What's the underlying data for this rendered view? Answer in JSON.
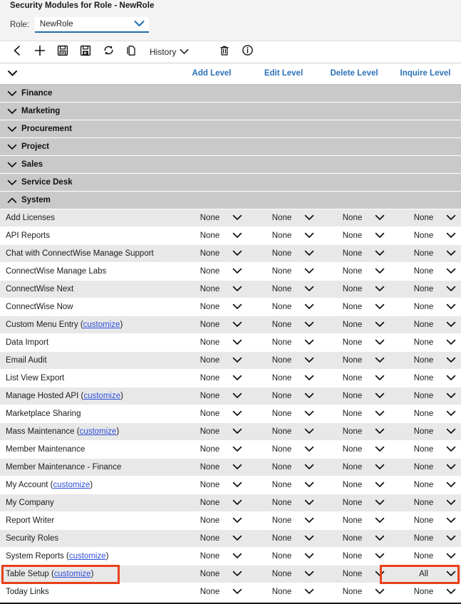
{
  "header": {
    "title": "Security Modules for Role - NewRole",
    "role_label": "Role:",
    "role_value": "NewRole"
  },
  "toolbar": {
    "items": [
      {
        "name": "back-button",
        "icon": "chevron-left-icon",
        "label": ""
      },
      {
        "name": "add-button",
        "icon": "plus-icon",
        "label": ""
      },
      {
        "name": "save-button",
        "icon": "save-icon",
        "label": ""
      },
      {
        "name": "save-and-close-button",
        "icon": "save-and-close-icon",
        "label": ""
      },
      {
        "name": "refresh-button",
        "icon": "refresh-icon",
        "label": ""
      },
      {
        "name": "copy-button",
        "icon": "copy-icon",
        "label": ""
      }
    ],
    "history_label": "History",
    "delete_label": "",
    "info_label": ""
  },
  "columns": [
    "Add Level",
    "Edit Level",
    "Delete Level",
    "Inquire Level"
  ],
  "groups": [
    {
      "label": "Finance",
      "expanded": false
    },
    {
      "label": "Marketing",
      "expanded": false
    },
    {
      "label": "Procurement",
      "expanded": false
    },
    {
      "label": "Project",
      "expanded": false
    },
    {
      "label": "Sales",
      "expanded": false
    },
    {
      "label": "Service Desk",
      "expanded": false
    },
    {
      "label": "System",
      "expanded": true
    }
  ],
  "customize_label": "customize",
  "rows": [
    {
      "name": "Add Licenses",
      "customize": false,
      "levels": [
        "None",
        "None",
        "None",
        "None"
      ]
    },
    {
      "name": "API Reports",
      "customize": false,
      "levels": [
        "None",
        "None",
        "None",
        "None"
      ]
    },
    {
      "name": "Chat with ConnectWise Manage Support",
      "customize": false,
      "levels": [
        "None",
        "None",
        "None",
        "None"
      ]
    },
    {
      "name": "ConnectWise Manage Labs",
      "customize": false,
      "levels": [
        "None",
        "None",
        "None",
        "None"
      ]
    },
    {
      "name": "ConnectWise Next",
      "customize": false,
      "levels": [
        "None",
        "None",
        "None",
        "None"
      ]
    },
    {
      "name": "ConnectWise Now",
      "customize": false,
      "levels": [
        "None",
        "None",
        "None",
        "None"
      ]
    },
    {
      "name": "Custom Menu Entry",
      "customize": true,
      "levels": [
        "None",
        "None",
        "None",
        "None"
      ]
    },
    {
      "name": "Data Import",
      "customize": false,
      "levels": [
        "None",
        "None",
        "None",
        "None"
      ]
    },
    {
      "name": "Email Audit",
      "customize": false,
      "levels": [
        "None",
        "None",
        "None",
        "None"
      ]
    },
    {
      "name": "List View Export",
      "customize": false,
      "levels": [
        "None",
        "None",
        "None",
        "None"
      ]
    },
    {
      "name": "Manage Hosted API",
      "customize": true,
      "levels": [
        "None",
        "None",
        "None",
        "None"
      ]
    },
    {
      "name": "Marketplace Sharing",
      "customize": false,
      "levels": [
        "None",
        "None",
        "None",
        "None"
      ]
    },
    {
      "name": "Mass Maintenance",
      "customize": true,
      "levels": [
        "None",
        "None",
        "None",
        "None"
      ]
    },
    {
      "name": "Member Maintenance",
      "customize": false,
      "levels": [
        "None",
        "None",
        "None",
        "None"
      ]
    },
    {
      "name": "Member Maintenance - Finance",
      "customize": false,
      "levels": [
        "None",
        "None",
        "None",
        "None"
      ]
    },
    {
      "name": "My Account",
      "customize": true,
      "levels": [
        "None",
        "None",
        "None",
        "None"
      ]
    },
    {
      "name": "My Company",
      "customize": false,
      "levels": [
        "None",
        "None",
        "None",
        "None"
      ]
    },
    {
      "name": "Report Writer",
      "customize": false,
      "levels": [
        "None",
        "None",
        "None",
        "None"
      ]
    },
    {
      "name": "Security Roles",
      "customize": false,
      "levels": [
        "None",
        "None",
        "None",
        "None"
      ]
    },
    {
      "name": "System Reports",
      "customize": true,
      "levels": [
        "None",
        "None",
        "None",
        "None"
      ]
    },
    {
      "name": "Table Setup",
      "customize": true,
      "levels": [
        "None",
        "None",
        "None",
        "All"
      ],
      "highlight_name": true,
      "highlight_col": 3
    },
    {
      "name": "Today Links",
      "customize": false,
      "levels": [
        "None",
        "None",
        "None",
        "None"
      ]
    }
  ],
  "colors": {
    "link": "#2f4fd8",
    "column_header": "#2b72b8",
    "accent": "#1f6cb0",
    "highlight": "#e8401a",
    "group_row": "#c9c9c9",
    "alt_row": "#e8e8e8"
  }
}
